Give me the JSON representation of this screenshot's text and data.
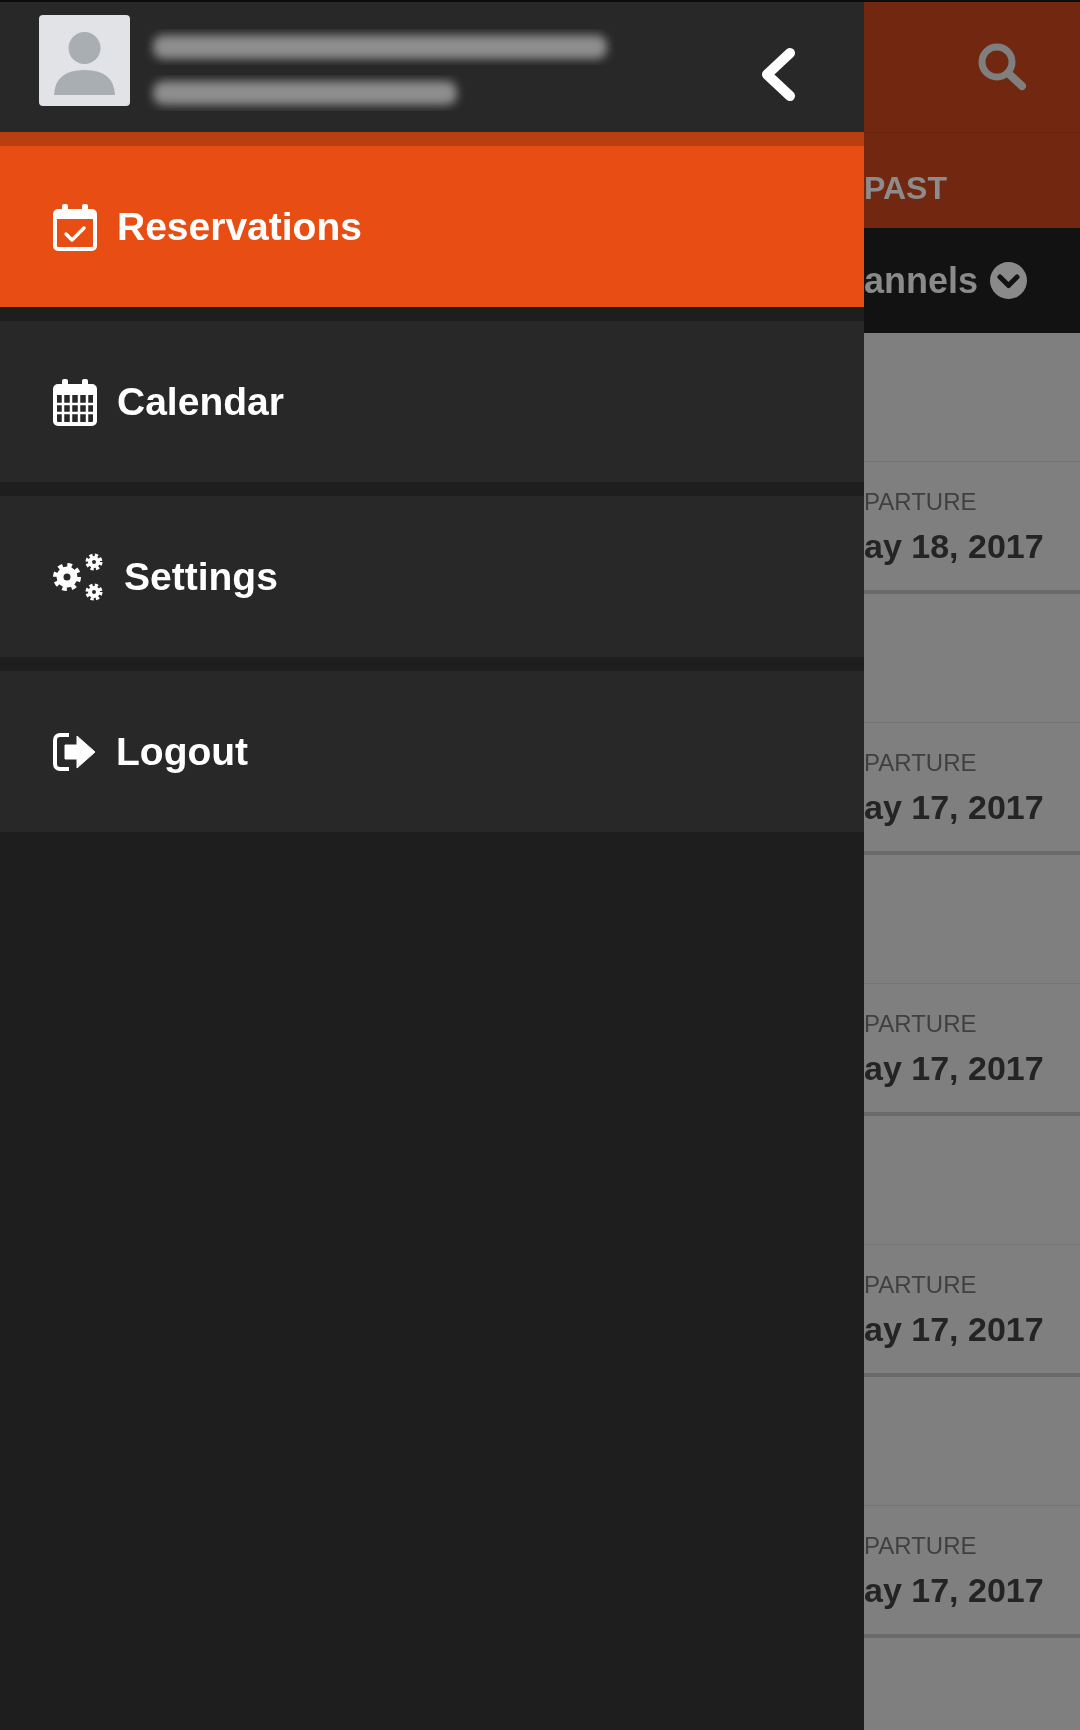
{
  "drawer": {
    "menu": [
      {
        "label": "Reservations",
        "selected": true
      },
      {
        "label": "Calendar",
        "selected": false
      },
      {
        "label": "Settings",
        "selected": false
      },
      {
        "label": "Logout",
        "selected": false
      }
    ]
  },
  "reservations_screen": {
    "tabs": [
      {
        "label": "PAST"
      }
    ],
    "filter": {
      "label": "annels"
    },
    "reservations": [
      {
        "label": "PARTURE",
        "date": "ay 18, 2017"
      },
      {
        "label": "PARTURE",
        "date": "ay 17, 2017"
      },
      {
        "label": "PARTURE",
        "date": "ay 17, 2017"
      },
      {
        "label": "PARTURE",
        "date": "ay 17, 2017"
      },
      {
        "label": "PARTURE",
        "date": "ay 17, 2017"
      }
    ]
  }
}
